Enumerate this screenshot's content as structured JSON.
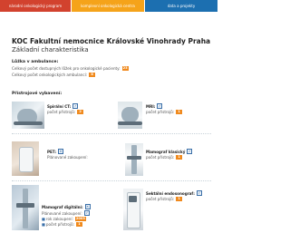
{
  "nav": {
    "tabs": [
      {
        "label": "národní onkologický program"
      },
      {
        "label": "komplexní onkologická centra"
      },
      {
        "label": "data a projekty"
      }
    ]
  },
  "header": {
    "title": "KOC Fakultní nemocnice Královské Vinohrady Praha",
    "subtitle": "Základní charakteristika"
  },
  "beds": {
    "heading": "Lůžka v ambulance:",
    "rows": [
      {
        "label": "Celkový počet dostupných lůžek pro onkologické pacienty:",
        "count": "23"
      },
      {
        "label": "Celkový počet onkologických ambulancí:",
        "count": "8"
      }
    ]
  },
  "equipment": {
    "heading": "Přístrojové vybavení:",
    "items": [
      {
        "name": "Spirální CT:",
        "count_label": "počet přístrojů:",
        "count": "2",
        "checked": "✓"
      },
      {
        "name": "MRI:",
        "count_label": "počet přístrojů:",
        "count": "1",
        "checked": "✓"
      },
      {
        "name": "PET:",
        "planned_label": "Plánované zakoupení:",
        "checked": "✕"
      },
      {
        "name": "Mamograf klasický",
        "count_label": "počet přístrojů:",
        "count": "1",
        "checked": "✓"
      },
      {
        "name": "Mamograf digitální:",
        "planned_label": "Plánované zakoupení:",
        "year_label": "rok zakoupení:",
        "year": "2003",
        "count_label": "počet přístrojů:",
        "count": "1",
        "checked": "✕"
      },
      {
        "name": "Sektální endosonograf:",
        "count_label": "počet přístrojů:",
        "count": "1",
        "checked": "✓"
      }
    ]
  }
}
